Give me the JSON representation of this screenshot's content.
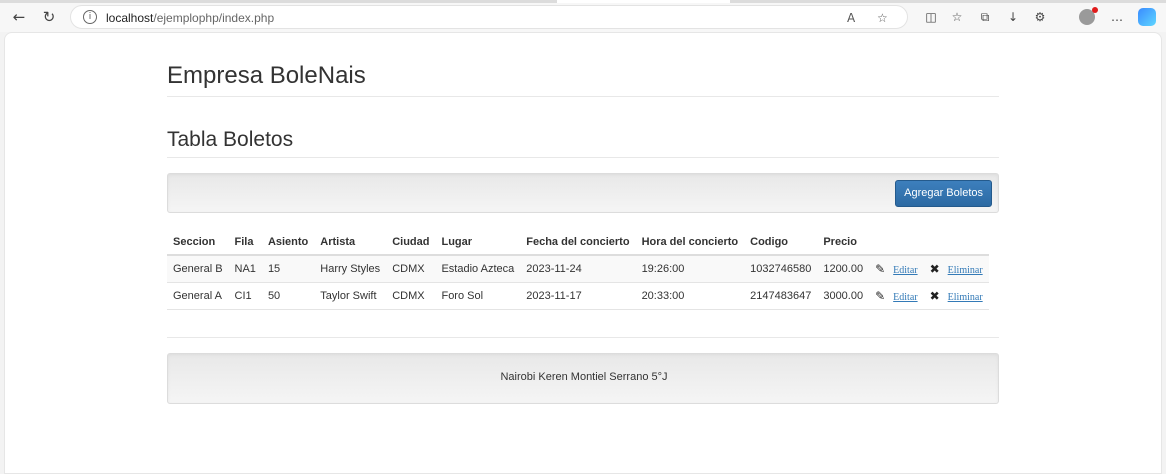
{
  "browser": {
    "url_host": "localhost",
    "url_path": "/ejemplophp/index.php"
  },
  "page": {
    "brand_title": "Empresa BoleNais",
    "section_title": "Tabla Boletos",
    "add_button_label": "Agregar Boletos",
    "table": {
      "headers": [
        "Seccion",
        "Fila",
        "Asiento",
        "Artista",
        "Ciudad",
        "Lugar",
        "Fecha del concierto",
        "Hora del concierto",
        "Codigo",
        "Precio"
      ],
      "rows": [
        {
          "seccion": "General B",
          "fila": "NA1",
          "asiento": "15",
          "artista": "Harry Styles",
          "ciudad": "CDMX",
          "lugar": "Estadio Azteca",
          "fecha": "2023-11-24",
          "hora": "19:26:00",
          "codigo": "1032746580",
          "precio": "1200.00",
          "edit_label": "Editar",
          "delete_label": "Eliminar"
        },
        {
          "seccion": "General A",
          "fila": "CI1",
          "asiento": "50",
          "artista": "Taylor Swift",
          "ciudad": "CDMX",
          "lugar": "Foro Sol",
          "fecha": "2023-11-17",
          "hora": "20:33:00",
          "codigo": "2147483647",
          "precio": "3000.00",
          "edit_label": "Editar",
          "delete_label": "Eliminar"
        }
      ]
    },
    "footer_text": "Nairobi Keren Montiel Serrano 5°J"
  }
}
